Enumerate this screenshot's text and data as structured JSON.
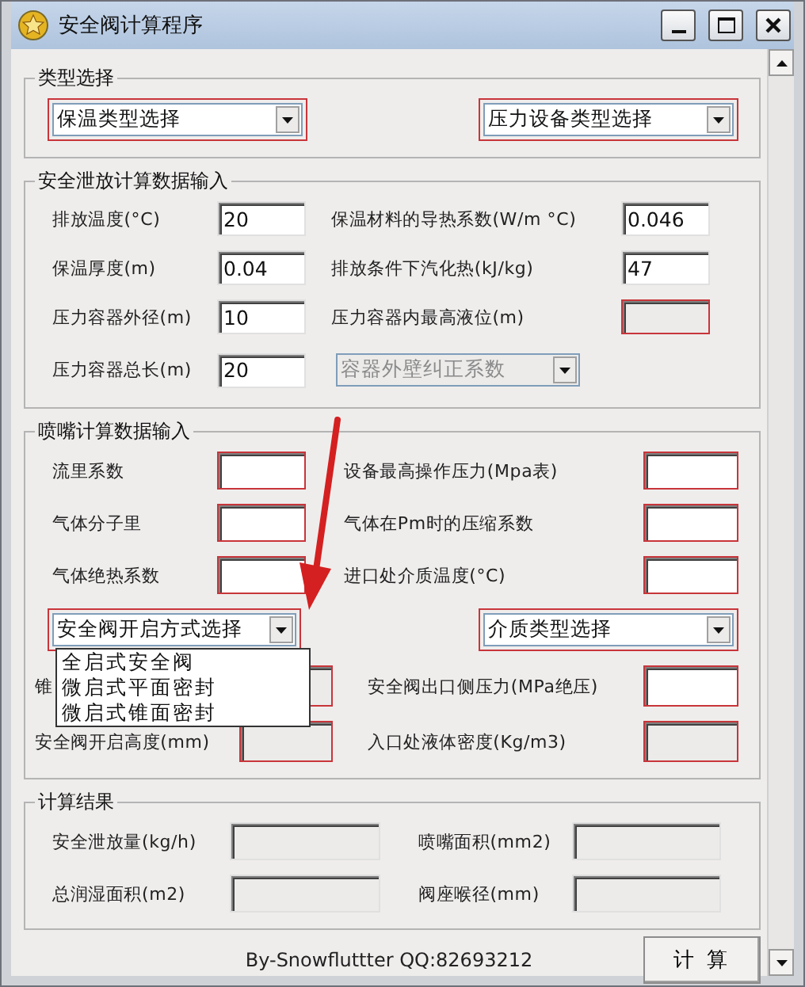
{
  "window": {
    "title": "安全阀计算程序"
  },
  "groups": [
    {
      "title": "类型选择",
      "rows": [
        [
          {
            "kind": "combo",
            "value": "保温类型选择",
            "highlighted": true,
            "disabled": false
          },
          {
            "kind": "combo",
            "value": "压力设备类型选择",
            "highlighted": true,
            "disabled": false
          }
        ]
      ]
    },
    {
      "title": "安全泄放计算数据输入",
      "rows": [
        [
          {
            "kind": "label",
            "text": "排放温度(°C)"
          },
          {
            "kind": "field",
            "value": "20",
            "highlighted": false,
            "disabled": false
          },
          {
            "kind": "label",
            "text": "保温材料的导热系数(W/m °C)"
          },
          {
            "kind": "field",
            "value": "0.046",
            "highlighted": false,
            "disabled": false
          }
        ],
        [
          {
            "kind": "label",
            "text": "保温厚度(m)"
          },
          {
            "kind": "field",
            "value": "0.04",
            "highlighted": false,
            "disabled": false
          },
          {
            "kind": "label",
            "text": "排放条件下汽化热(kJ/kg)"
          },
          {
            "kind": "field",
            "value": "47",
            "highlighted": false,
            "disabled": false
          }
        ],
        [
          {
            "kind": "label",
            "text": "压力容器外径(m)"
          },
          {
            "kind": "field",
            "value": "10",
            "highlighted": false,
            "disabled": false
          },
          {
            "kind": "label",
            "text": "压力容器内最高液位(m)"
          },
          {
            "kind": "field",
            "highlighted": true,
            "disabled": true
          }
        ],
        [
          {
            "kind": "label",
            "text": "压力容器总长(m)"
          },
          {
            "kind": "field",
            "value": "20",
            "highlighted": false,
            "disabled": false
          },
          {
            "kind": "combo",
            "value": "容器外壁纠正系数",
            "highlighted": false,
            "disabled": true
          }
        ]
      ]
    },
    {
      "title": "喷嘴计算数据输入",
      "rows": [
        [
          {
            "kind": "label",
            "text": "流里系数"
          },
          {
            "kind": "field",
            "highlighted": true,
            "disabled": false
          },
          {
            "kind": "label",
            "text": "设备最高操作压力(Mpa表)"
          },
          {
            "kind": "field",
            "highlighted": true,
            "disabled": false
          }
        ],
        [
          {
            "kind": "label",
            "text": "气体分子里"
          },
          {
            "kind": "field",
            "highlighted": true,
            "disabled": false
          },
          {
            "kind": "label",
            "text": "气体在Pm时的压缩系数"
          },
          {
            "kind": "field",
            "highlighted": true,
            "disabled": false
          }
        ],
        [
          {
            "kind": "label",
            "text": "气体绝热系数"
          },
          {
            "kind": "field",
            "highlighted": true,
            "disabled": false
          },
          {
            "kind": "label",
            "text": "进口处介质温度(°C)"
          },
          {
            "kind": "field",
            "highlighted": true,
            "disabled": false
          }
        ],
        [
          {
            "kind": "combo",
            "value": "安全阀开启方式选择",
            "highlighted": true,
            "disabled": false,
            "expanded": true,
            "options": [
              {
                "text": "全启式安全阀",
                "selected": false
              },
              {
                "text": "微启式平面密封",
                "selected": false
              },
              {
                "text": "微启式锥面密封",
                "selected": false
              }
            ]
          },
          {
            "kind": "combo",
            "value": "介质类型选择",
            "highlighted": true,
            "disabled": false
          }
        ],
        [
          {
            "kind": "label",
            "text": "锥"
          },
          {
            "kind": "field",
            "highlighted": true,
            "disabled": true
          },
          {
            "kind": "label",
            "text": "安全阀出口侧压力(MPa绝压)"
          },
          {
            "kind": "field",
            "highlighted": true,
            "disabled": false
          }
        ],
        [
          {
            "kind": "label",
            "text": "安全阀开启高度(mm)"
          },
          {
            "kind": "field",
            "highlighted": true,
            "disabled": true
          },
          {
            "kind": "label",
            "text": "入口处液体密度(Kg/m3)"
          },
          {
            "kind": "field",
            "highlighted": true,
            "disabled": true
          }
        ]
      ]
    },
    {
      "title": "计算结果",
      "rows": [
        [
          {
            "kind": "label",
            "text": "安全泄放量(kg/h)"
          },
          {
            "kind": "field",
            "highlighted": false,
            "disabled": true
          },
          {
            "kind": "label",
            "text": "喷嘴面积(mm2)"
          },
          {
            "kind": "field",
            "highlighted": false,
            "disabled": true
          }
        ],
        [
          {
            "kind": "label",
            "text": "总润湿面积(m2)"
          },
          {
            "kind": "field",
            "highlighted": false,
            "disabled": true
          },
          {
            "kind": "label",
            "text": "阀座喉径(mm)"
          },
          {
            "kind": "field",
            "highlighted": false,
            "disabled": true
          }
        ]
      ]
    }
  ],
  "footer": {
    "credit": "By-Snowfluttter QQ:82693212",
    "button": "计 算"
  }
}
